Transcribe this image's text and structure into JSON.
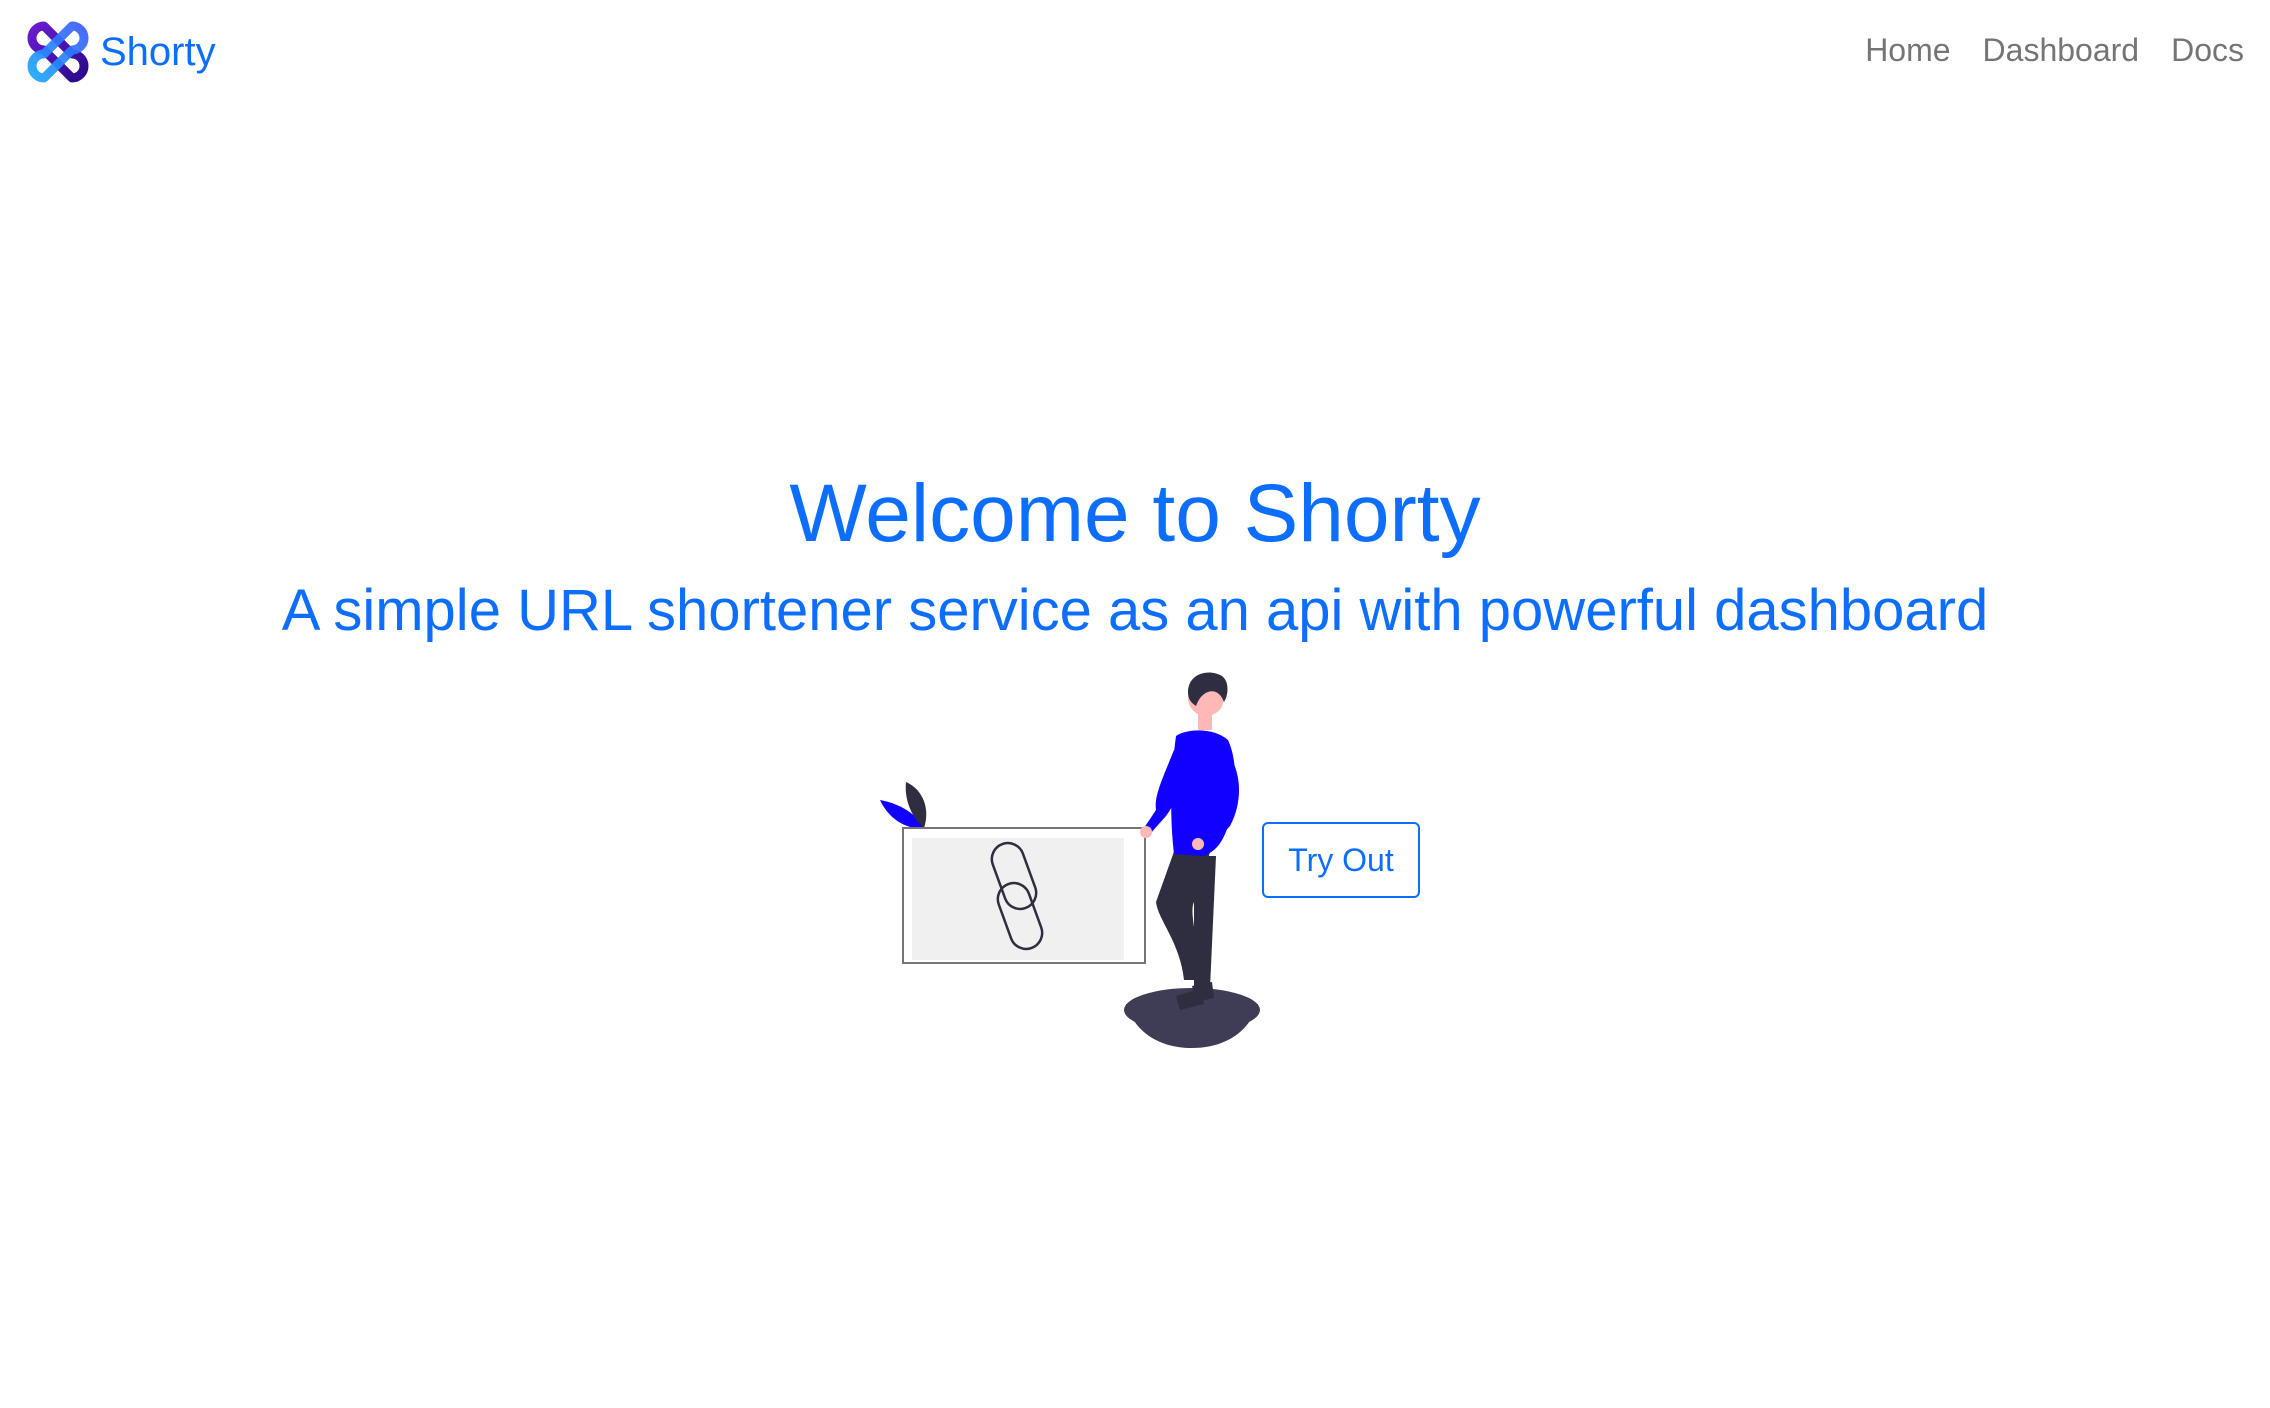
{
  "brand": {
    "name": "Shorty",
    "logo_icon": "infinity-knot-logo-icon"
  },
  "nav": {
    "items": [
      {
        "label": "Home"
      },
      {
        "label": "Dashboard"
      },
      {
        "label": "Docs"
      }
    ]
  },
  "hero": {
    "title": "Welcome to Shorty",
    "subtitle": "A simple URL shortener service as an api with powerful dashboard",
    "cta_label": "Try Out",
    "illustration": "person-with-link-card-illustration"
  },
  "colors": {
    "primary": "#0d6efd",
    "nav_text": "#757575",
    "illustration_accent": "#1100ff",
    "illustration_dark": "#2f2e41"
  }
}
